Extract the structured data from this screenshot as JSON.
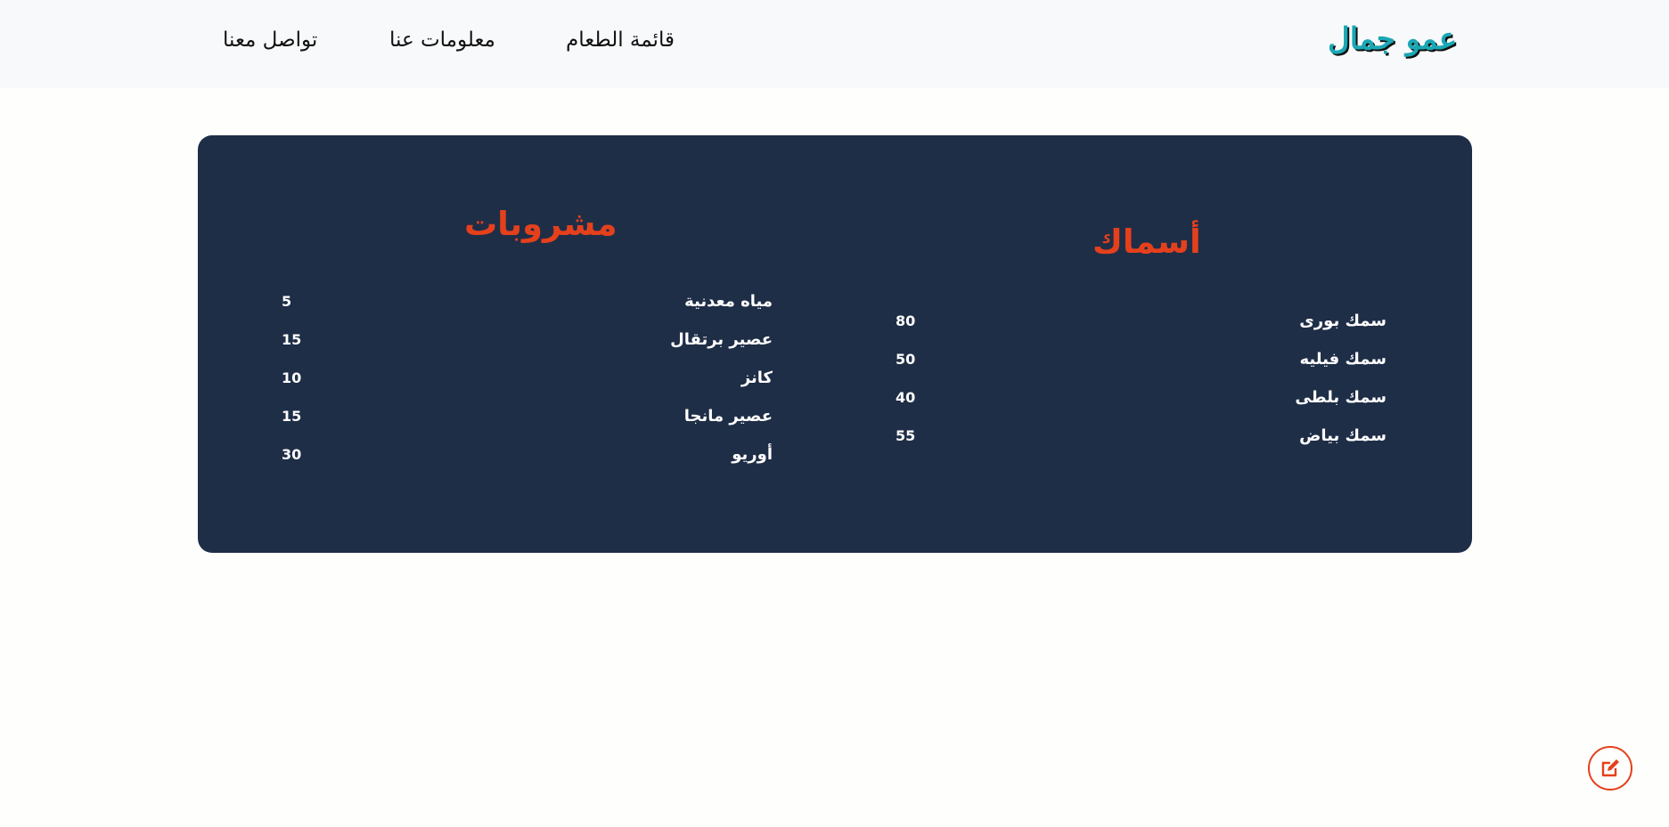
{
  "navbar": {
    "brand": "عمو جمال",
    "links": {
      "menu": "قائمة الطعام",
      "about": "معلومات عنا",
      "contact": "تواصل معنا"
    }
  },
  "menu": {
    "fish": {
      "title": "أسماك",
      "items": [
        {
          "name": "سمك بورى",
          "price": "80"
        },
        {
          "name": "سمك فيليه",
          "price": "50"
        },
        {
          "name": "سمك بلطى",
          "price": "40"
        },
        {
          "name": "سمك بياض",
          "price": "55"
        }
      ]
    },
    "drinks": {
      "title": "مشروبات",
      "items": [
        {
          "name": "مياه معدنية",
          "price": "5"
        },
        {
          "name": "عصير برتقال",
          "price": "15"
        },
        {
          "name": "كانز",
          "price": "10"
        },
        {
          "name": "عصير مانجا",
          "price": "15"
        },
        {
          "name": "أوريو",
          "price": "30"
        }
      ]
    }
  },
  "fab": {
    "icon": "edit-icon"
  },
  "colors": {
    "accent": "#e5401c",
    "card_bg": "#1f2e47",
    "brand": "#1aa7b5",
    "navbar_bg": "#f8f9fa"
  }
}
